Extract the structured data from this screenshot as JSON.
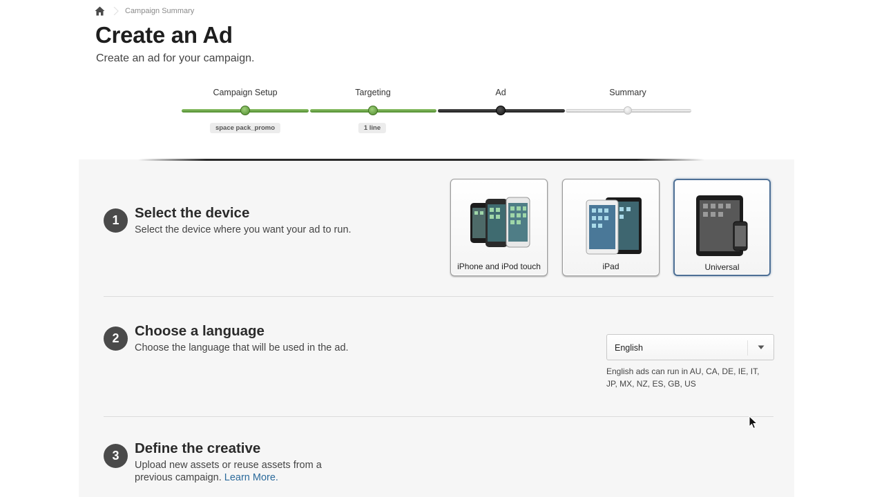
{
  "breadcrumb": {
    "home_icon": "home-icon",
    "separator_icon": "chevron-right-icon",
    "current": "Campaign Summary"
  },
  "header": {
    "title": "Create an Ad",
    "subtitle": "Create an ad for your campaign."
  },
  "stepper": {
    "steps": [
      {
        "label": "Campaign Setup",
        "status": "complete",
        "badge": "space pack_promo"
      },
      {
        "label": "Targeting",
        "status": "complete",
        "badge": "1 line"
      },
      {
        "label": "Ad",
        "status": "current",
        "badge": ""
      },
      {
        "label": "Summary",
        "status": "upcoming",
        "badge": ""
      }
    ],
    "colors": {
      "complete": "#5a9a35",
      "current": "#2a2a2a",
      "upcoming": "#d8d8d8"
    }
  },
  "sections": [
    {
      "number": "1",
      "title": "Select the device",
      "description": "Select the device where you want your ad to run."
    },
    {
      "number": "2",
      "title": "Choose a language",
      "description": "Choose the language that will be used in the ad."
    },
    {
      "number": "3",
      "title": "Define the creative",
      "description_line1": "Upload new assets or reuse assets from a",
      "description_line2": "previous campaign.",
      "link": "Learn More."
    }
  ],
  "devices": {
    "options": [
      {
        "label": "iPhone and iPod touch",
        "icon": "iphone-icon",
        "selected": false
      },
      {
        "label": "iPad",
        "icon": "ipad-icon",
        "selected": false
      },
      {
        "label": "Universal",
        "icon": "universal-device-icon",
        "selected": true
      }
    ]
  },
  "language": {
    "selected": "English",
    "note_line1": "English ads can run in AU, CA, DE, IE, IT,",
    "note_line2": "JP, MX, NZ, ES, GB, US"
  },
  "colors": {
    "accent_link": "#2b6a9b",
    "selected_border": "#4d6f95",
    "step_circle": "#4a4a4a"
  }
}
